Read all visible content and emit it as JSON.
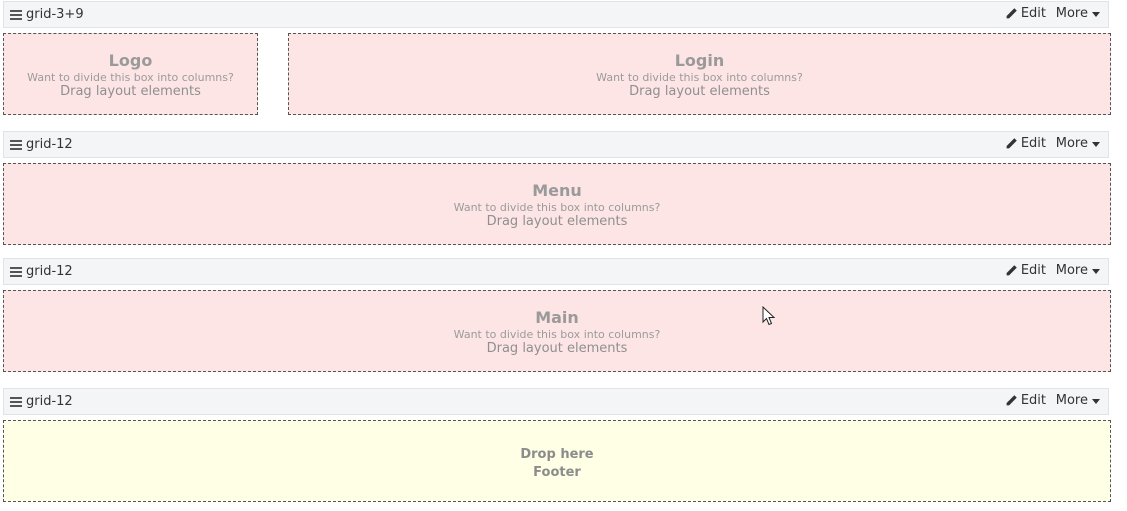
{
  "rows": [
    {
      "title": "grid-3+9",
      "edit_label": "Edit",
      "more_label": "More",
      "cells": [
        {
          "title": "Logo",
          "hint": "Want to divide this box into columns?",
          "drag": "Drag layout elements"
        },
        {
          "title": "Login",
          "hint": "Want to divide this box into columns?",
          "drag": "Drag layout elements"
        }
      ]
    },
    {
      "title": "grid-12",
      "edit_label": "Edit",
      "more_label": "More",
      "cells": [
        {
          "title": "Menu",
          "hint": "Want to divide this box into columns?",
          "drag": "Drag layout elements"
        }
      ]
    },
    {
      "title": "grid-12",
      "edit_label": "Edit",
      "more_label": "More",
      "cells": [
        {
          "title": "Main",
          "hint": "Want to divide this box into columns?",
          "drag": "Drag layout elements"
        }
      ]
    },
    {
      "title": "grid-12",
      "edit_label": "Edit",
      "more_label": "More",
      "drop": {
        "line1": "Drop here",
        "line2": "Footer"
      }
    }
  ],
  "colors": {
    "cell_bg": "#fee5e5",
    "drop_bg": "#ffffe6",
    "header_bg": "#f4f5f7"
  },
  "icons": [
    "drag-handle-icon",
    "pencil-icon",
    "caret-down-icon",
    "mouse-cursor-icon"
  ]
}
